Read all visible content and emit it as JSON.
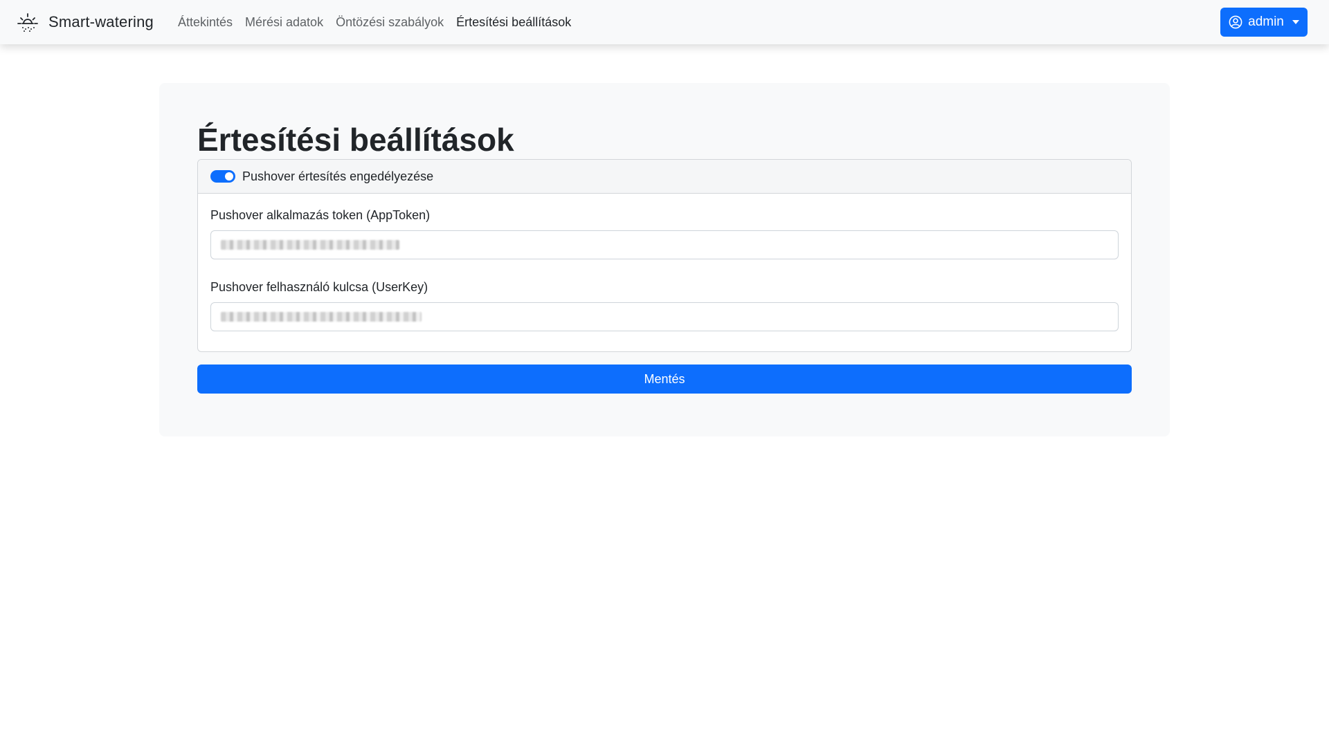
{
  "app": {
    "brand_name": "Smart-watering",
    "brand_icon": "sun-drops-icon"
  },
  "nav": {
    "items": [
      {
        "label": "Áttekintés",
        "active": false
      },
      {
        "label": "Mérési adatok",
        "active": false
      },
      {
        "label": "Öntözési szabályok",
        "active": false
      },
      {
        "label": "Értesítési beállítások",
        "active": true
      }
    ]
  },
  "user_menu": {
    "label": "admin",
    "icon": "user-circle-icon",
    "color": "#0d6efd"
  },
  "page": {
    "title": "Értesítési beállítások"
  },
  "pushover": {
    "toggle_label": "Pushover értesítés engedélyezése",
    "enabled": true,
    "app_token_label": "Pushover alkalmazás token (AppToken)",
    "user_key_label": "Pushover felhasználó kulcsa (UserKey)"
  },
  "actions": {
    "save_label": "Mentés"
  },
  "colors": {
    "primary": "#0d6efd",
    "navbar_bg": "#f8f9fa",
    "panel_bg": "#f8f9fa"
  }
}
